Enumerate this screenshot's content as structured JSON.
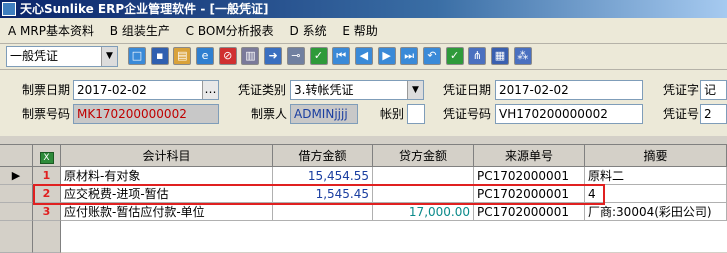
{
  "window": {
    "title": "天心Sunlike ERP企业管理软件 - [一般凭证]"
  },
  "menu": [
    {
      "key": "A",
      "label": "A MRP基本资料"
    },
    {
      "key": "B",
      "label": "B 组装生产"
    },
    {
      "key": "C",
      "label": "C BOM分析报表"
    },
    {
      "key": "D",
      "label": "D 系统"
    },
    {
      "key": "E",
      "label": "E 帮助"
    }
  ],
  "toolbar": {
    "voucher_type_select": "一般凭证",
    "icons": [
      "new-icon",
      "save-icon",
      "open-icon",
      "ie-icon",
      "delete-icon",
      "print-icon",
      "export-icon",
      "key-icon",
      "check-icon",
      "first-icon",
      "prev-icon",
      "next-icon",
      "last-icon",
      "undo-icon",
      "multi-check-icon",
      "tree-icon",
      "grid-icon",
      "network-icon"
    ]
  },
  "header": {
    "labels": {
      "voucher_date": "制票日期",
      "voucher_no": "制票号码",
      "voucher_category": "凭证类别",
      "maker": "制票人",
      "account_book": "帐别",
      "cert_date": "凭证日期",
      "cert_no": "凭证号码",
      "cert_word": "凭证字",
      "cert_number": "凭证号"
    },
    "values": {
      "voucher_date": "2017-02-02",
      "voucher_no": "MK170200000002",
      "voucher_category": "3.转帐凭证",
      "maker": "ADMINjjjj",
      "account_book": "",
      "cert_date": "2017-02-02",
      "cert_no": "VH170200000002",
      "cert_word": "记",
      "cert_number": "2"
    },
    "colors": {
      "voucher_no_text": "#c00000",
      "maker_text": "#1a3ea0",
      "readonly_bg": "#c8c8c8"
    }
  },
  "grid": {
    "columns": [
      "会计科目",
      "借方金额",
      "贷方金额",
      "来源单号",
      "摘要"
    ],
    "rows": [
      {
        "num": "1",
        "account": "原材料-有对象",
        "debit": "15,454.55",
        "credit": "",
        "source": "PC1702000001",
        "summary": "原料二"
      },
      {
        "num": "2",
        "account": "应交税费-进项-暂估",
        "debit": "1,545.45",
        "credit": "",
        "source": "PC1702000001",
        "summary": "4"
      },
      {
        "num": "3",
        "account": "应付账款-暂估应付款-单位",
        "debit": "",
        "credit": "17,000.00",
        "source": "PC1702000001",
        "summary": "厂商:30004(彩田公司)"
      }
    ],
    "colors": {
      "debit_text": "#1a3ea0",
      "credit_text": "#0a8a8a",
      "row_num_text": "#e02020",
      "highlight_border": "#e02020"
    }
  }
}
